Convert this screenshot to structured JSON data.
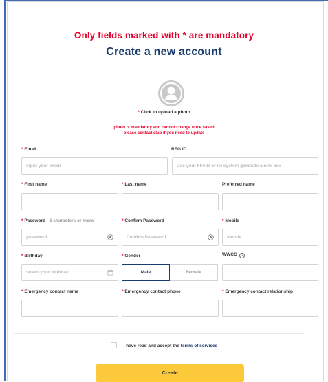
{
  "header": {
    "mandatory_notice": "Only fields marked with * are mandatory",
    "title": "Create a new account"
  },
  "photo": {
    "upload_label": "Click to upload a photo",
    "warning_line1": "photo is mandatory and cannot change once saved",
    "warning_line2": "please contact club if you need to update"
  },
  "form": {
    "required_mark": "*",
    "email": {
      "label": "Email",
      "placeholder": "input your email"
    },
    "reg_id": {
      "label": "REG ID",
      "placeholder": "Use your FFAID or let system generate a new one"
    },
    "first_name": {
      "label": "First name",
      "value": ""
    },
    "last_name": {
      "label": "Last name",
      "value": ""
    },
    "preferred_name": {
      "label": "Preferred name",
      "value": ""
    },
    "password": {
      "label": "Password",
      "hint": "6 characters or more",
      "placeholder": "password"
    },
    "confirm_password": {
      "label": "Confirm Password",
      "placeholder": "Confirm Password"
    },
    "mobile": {
      "label": "Mobile",
      "placeholder": "mobile"
    },
    "birthday": {
      "label": "Birthday",
      "placeholder": "select your birthday."
    },
    "gender": {
      "label": "Gender",
      "options": [
        "Male",
        "Female"
      ],
      "selected": "Male"
    },
    "wwcc": {
      "label": "WWCC",
      "info_icon": "?"
    },
    "emergency_name": {
      "label": "Emergency contact name"
    },
    "emergency_phone": {
      "label": "Emergency contact phone"
    },
    "emergency_relationship": {
      "label": "Emergency contact relationship"
    }
  },
  "terms": {
    "prefix": "I have read and accept the",
    "link": "terms of services",
    "checked": false
  },
  "actions": {
    "create_label": "Create"
  },
  "colors": {
    "accent_red": "#e4002b",
    "title_navy": "#1a3c6e",
    "button_yellow": "#fcc93b",
    "frame_blue": "#3f6fb2"
  },
  "icons": {
    "avatar": "user-avatar-icon",
    "password_toggle": "eye-icon",
    "birthday": "calendar-icon",
    "wwcc_info": "question-circle-icon"
  }
}
